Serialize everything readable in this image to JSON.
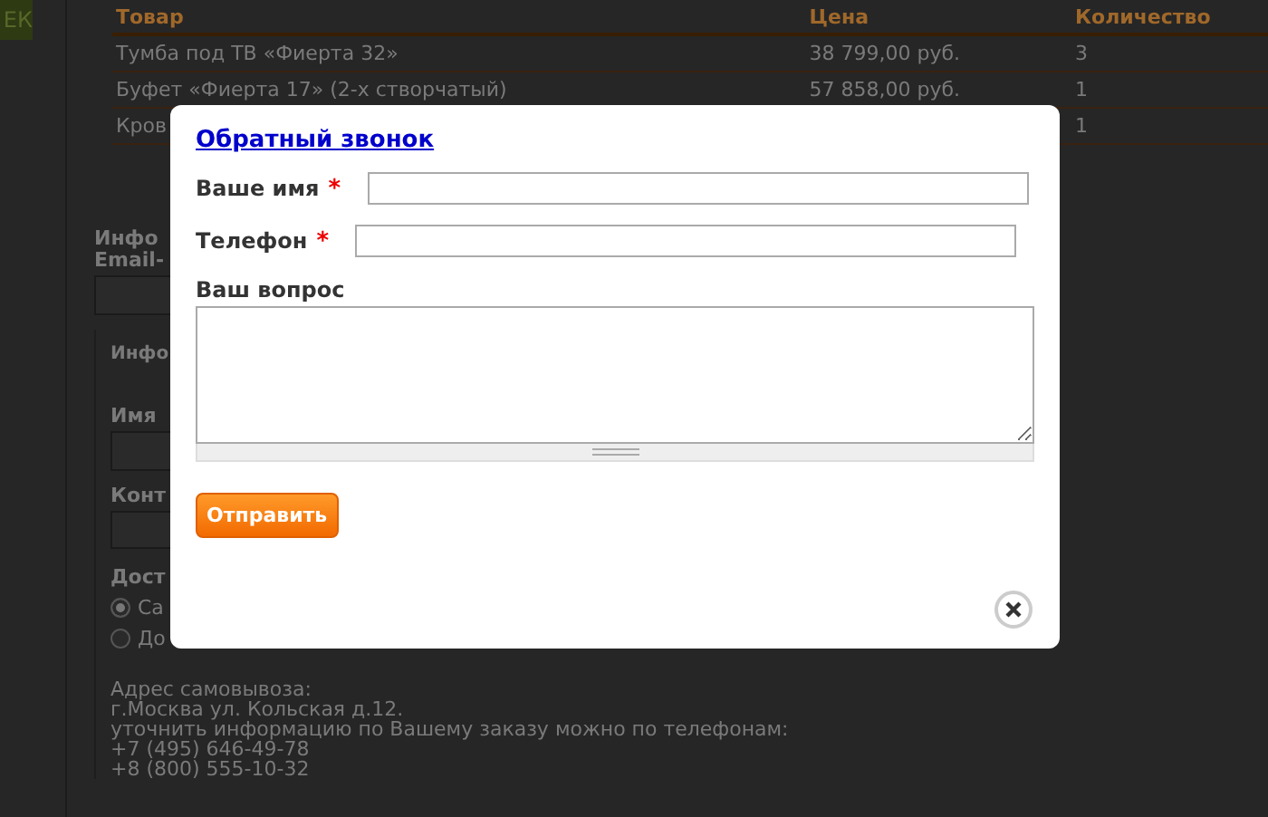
{
  "page": {
    "top_button": "ЕК",
    "order_table": {
      "columns": [
        "Товар",
        "Цена",
        "Количество"
      ],
      "rows": [
        [
          "Тумба под ТВ «Фиерта 32»",
          "38 799,00 руб.",
          "3"
        ],
        [
          "Буфет «Фиерта 17» (2-х створчатый)",
          "57 858,00 руб.",
          "1"
        ],
        [
          "Кров",
          "",
          "1"
        ]
      ]
    },
    "info_heading": "Инфо",
    "email_label": "Email-",
    "info_box": {
      "title": "Инфо",
      "name_label": "Имя",
      "contact_label": "Конт",
      "delivery_label": "Дост",
      "delivery_options": [
        {
          "label": "Са",
          "selected": true
        },
        {
          "label": "До",
          "selected": false
        }
      ],
      "pickup_lines": [
        "Адрес самовывоза:",
        "г.Москва ул. Кольская д.12.",
        "уточнить информацию по Вашему заказу можно по телефонам:",
        "+7 (495) 646-49-78",
        "+8 (800) 555-10-32"
      ]
    }
  },
  "dialog": {
    "title": "Обратный звонок",
    "fields": [
      {
        "label": "Ваше имя",
        "required": true,
        "kind": "input"
      },
      {
        "label": "Телефон",
        "required": true,
        "kind": "input"
      },
      {
        "label": "Ваш вопрос",
        "required": false,
        "kind": "textarea"
      }
    ],
    "required_mark": "*",
    "submit": "Отправить"
  }
}
